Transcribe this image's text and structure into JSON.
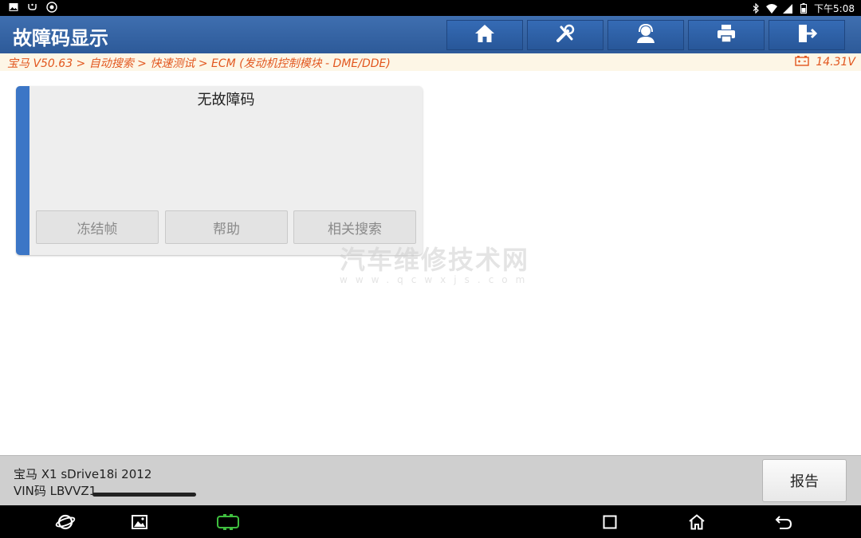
{
  "status_bar": {
    "time": "下午5:08",
    "left_icons": [
      "image-icon",
      "usb-icon",
      "settings-circle-icon"
    ],
    "right_icons": [
      "bluetooth-icon",
      "wifi-icon",
      "signal-icon",
      "battery-icon"
    ]
  },
  "header": {
    "title": "故障码显示",
    "buttons": [
      "home-icon",
      "diagnose-tools-icon",
      "support-agent-icon",
      "print-icon",
      "exit-icon"
    ]
  },
  "breadcrumb": {
    "path": "宝马 V50.63 > 自动搜索 > 快速测试 > ECM (发动机控制模块 - DME/DDE)",
    "voltage": "14.31V"
  },
  "card": {
    "message": "无故障码",
    "buttons": {
      "freeze_frame": "冻结帧",
      "help": "帮助",
      "related_search": "相关搜索"
    }
  },
  "watermark": {
    "line1": "汽车维修技术网",
    "line2": "www.qcwxjs.com"
  },
  "vehicle": {
    "model": "宝马 X1 sDrive18i 2012",
    "vin": "VIN码 LBVVZ1"
  },
  "report_button": "报告",
  "colors": {
    "header_blue": "#2d5a99",
    "card_accent": "#3c76c6",
    "breadcrumb_text": "#e2571f",
    "vci_green": "#3fbf3f"
  }
}
